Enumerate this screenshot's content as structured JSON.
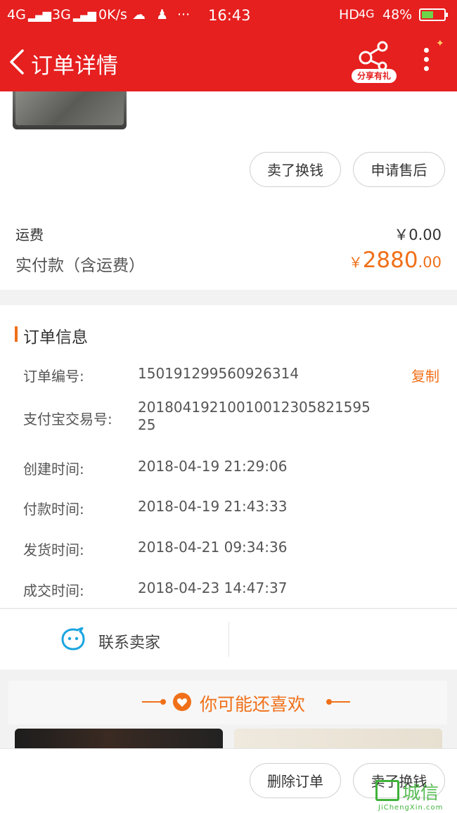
{
  "status_bar": {
    "signal1": "4G",
    "signal2": "3G",
    "speed": "0K/s",
    "dots": "···",
    "time": "16:43",
    "network": "HD",
    "network2": "4G",
    "battery": "48%"
  },
  "nav": {
    "title": "订单详情",
    "share_label": "分享有礼"
  },
  "product": {
    "buttons": [
      "卖了换钱",
      "申请售后"
    ],
    "shipping_label": "运费",
    "shipping_value": "￥0.00",
    "paid_label": "实付款（含运费）",
    "paid_currency": "￥",
    "paid_int": "2880",
    "paid_dec": ".00"
  },
  "order_info": {
    "title": "订单信息",
    "copy_label": "复制",
    "rows": [
      {
        "label": "订单编号:",
        "value": "150191299560926314"
      },
      {
        "label": "支付宝交易号:",
        "value": "20180419210010012305821595 25"
      },
      {
        "label": "创建时间:",
        "value": "2018-04-19 21:29:06"
      },
      {
        "label": "付款时间:",
        "value": "2018-04-19 21:43:33"
      },
      {
        "label": "发货时间:",
        "value": "2018-04-21 09:34:36"
      },
      {
        "label": "成交时间:",
        "value": "2018-04-23 14:47:37"
      }
    ]
  },
  "contact": {
    "label": "联系卖家"
  },
  "recommend": {
    "title": "你可能还喜欢"
  },
  "bottom": {
    "delete_label": "删除订单",
    "resell_label": "卖了换钱"
  },
  "watermark": {
    "text": "城信",
    "sub": "JiChengXin.com"
  },
  "colors": {
    "brand_red": "#e61f1f",
    "accent_orange": "#f07019"
  }
}
